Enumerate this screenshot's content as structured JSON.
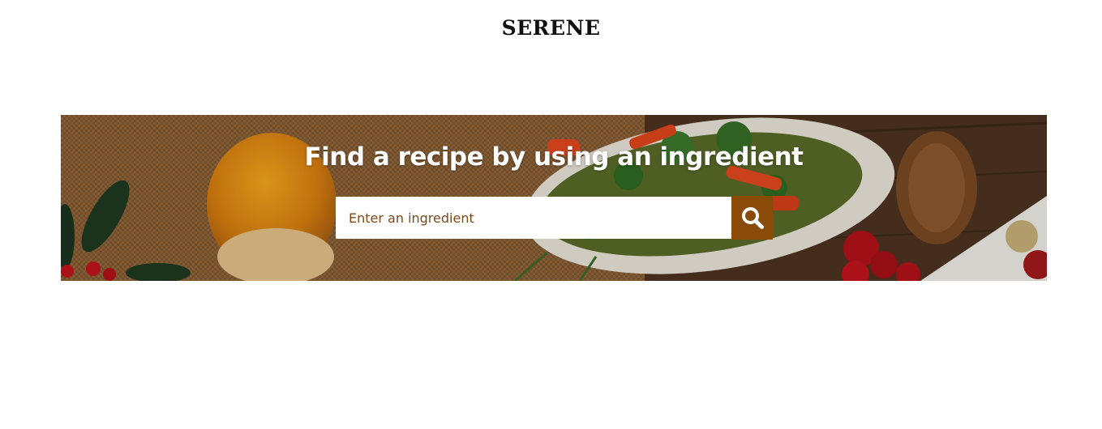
{
  "header": {
    "logo": "SERENE"
  },
  "hero": {
    "title": "Find a recipe by using an ingredient",
    "search": {
      "placeholder": "Enter an ingredient",
      "value": ""
    },
    "search_button_icon": "search-icon"
  },
  "colors": {
    "accent": "#8a4a08",
    "placeholder_text": "#7a4a1a",
    "hero_text": "#ffffff"
  }
}
